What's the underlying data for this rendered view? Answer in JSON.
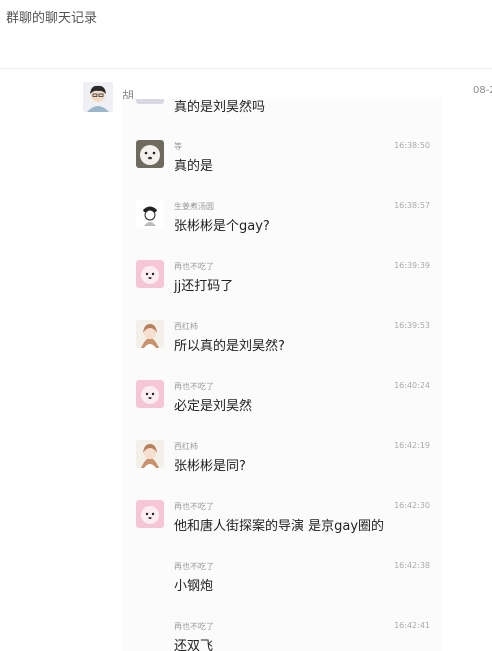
{
  "header": {
    "title": "群聊的聊天记录"
  },
  "post": {
    "sender": "胡",
    "date": "08-2"
  },
  "chat": {
    "first_line": "真的是刘昊然吗",
    "messages": [
      {
        "name": "等",
        "time": "16:38:50",
        "text": "真的是",
        "avatar": "white-dog"
      },
      {
        "name": "生姜煮汤圆",
        "time": "16:38:57",
        "text": "张彬彬是个gay?",
        "avatar": "sketch-character"
      },
      {
        "name": "再也不吃了",
        "time": "16:39:39",
        "text": "jj还打码了",
        "avatar": "pink-dog"
      },
      {
        "name": "西红柿",
        "time": "16:39:53",
        "text": "所以真的是刘昊然?",
        "avatar": "girl-portrait"
      },
      {
        "name": "再也不吃了",
        "time": "16:40:24",
        "text": "必定是刘昊然",
        "avatar": "pink-dog"
      },
      {
        "name": "西红柿",
        "time": "16:42:19",
        "text": "张彬彬是同?",
        "avatar": "girl-portrait"
      },
      {
        "name": "再也不吃了",
        "time": "16:42:30",
        "text": "他和唐人街探案的导演 是京gay圈的",
        "avatar": "pink-dog"
      },
      {
        "name": "再也不吃了",
        "time": "16:42:38",
        "text": "小钢炮",
        "avatar": "none"
      },
      {
        "name": "再也不吃了",
        "time": "16:42:41",
        "text": "还双飞",
        "avatar": "none"
      }
    ]
  }
}
